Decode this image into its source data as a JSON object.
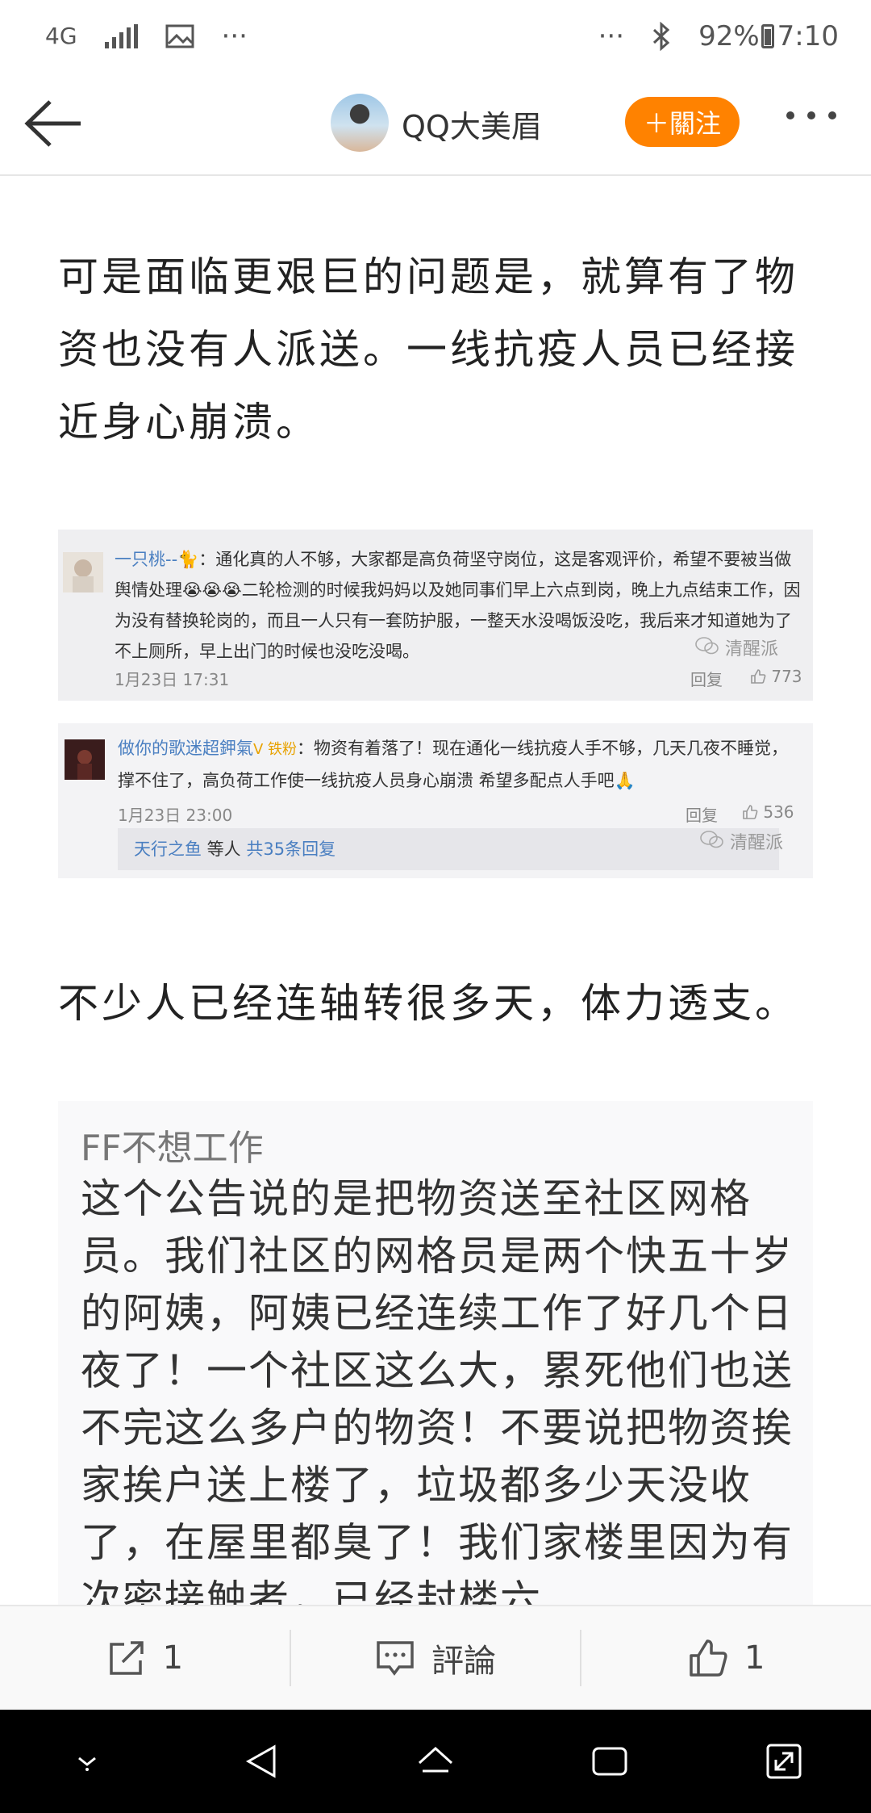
{
  "status_bar": {
    "network": "4G",
    "battery": "92%",
    "time": "7:10",
    "dots": "···"
  },
  "header": {
    "author": "QQ大美眉",
    "follow_label": "＋關注"
  },
  "article": {
    "paragraph1": "可是面临更艰巨的问题是，就算有了物资也没有人派送。一线抗疫人员已经接近身心崩溃。",
    "paragraph2": "不少人已经连轴转很多天，体力透支。"
  },
  "comment1": {
    "name": "一只桃--",
    "badge": "🐈",
    "text": "：通化真的人不够，大家都是高负荷坚守岗位，这是客观评价，希望不要被当做舆情处理😭😭😭二轮检测的时候我妈妈以及她同事们早上六点到岗，晚上九点结束工作，因为没有替换轮岗的，而且一人只有一套防护服，一整天水没喝饭没吃，我后来才知道她为了不上厕所，早上出门的时候也没吃没喝。",
    "time": "1月23日 17:31",
    "reply": "回复",
    "likes": "773",
    "watermark": "清醒派"
  },
  "comment2": {
    "name": "做你的歌迷超鉀氣",
    "badges": "V 铁粉",
    "text": "：物资有着落了！现在通化一线抗疫人手不够，几天几夜不睡觉，撑不住了，高负荷工作使一线抗疫人员身心崩溃 希望多配点人手吧🙏",
    "time": "1月23日 23:00",
    "reply": "回复",
    "likes": "536",
    "reply_user": "天行之鱼",
    "reply_mid": " 等人 ",
    "reply_count": "共35条回复",
    "watermark": "清醒派"
  },
  "screenshot": {
    "title": "FF不想工作",
    "body": "这个公告说的是把物资送至社区网格员。我们社区的网格员是两个快五十岁的阿姨，阿姨已经连续工作了好几个日夜了！一个社区这么大，累死他们也送不完这么多户的物资！不要说把物资挨家挨户送上楼了，垃圾都多少天没收了，在屋里都臭了！我们家楼里因为有次密接触者，已经封楼六"
  },
  "actions": {
    "share_count": "1",
    "comment_label": "評論",
    "like_count": "1"
  },
  "colors": {
    "accent": "#ff8200",
    "link": "#4a7fc1"
  }
}
